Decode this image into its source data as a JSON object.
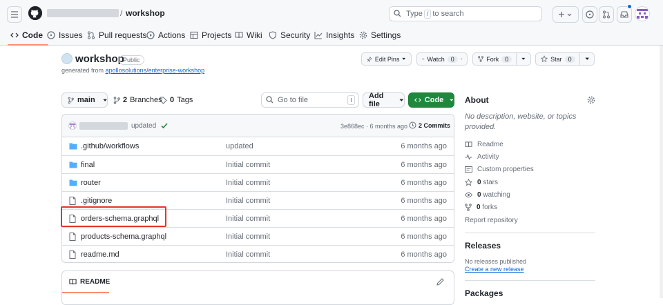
{
  "header": {
    "repo_name": "workshop",
    "slash": "/",
    "search_prefix": "Type",
    "search_key": "/",
    "search_suffix": "to search"
  },
  "tabs": [
    {
      "label": "Code",
      "icon": "code-icon",
      "active": true
    },
    {
      "label": "Issues",
      "icon": "issue-icon"
    },
    {
      "label": "Pull requests",
      "icon": "pull-request-icon"
    },
    {
      "label": "Actions",
      "icon": "play-icon"
    },
    {
      "label": "Projects",
      "icon": "table-icon"
    },
    {
      "label": "Wiki",
      "icon": "book-icon"
    },
    {
      "label": "Security",
      "icon": "shield-icon"
    },
    {
      "label": "Insights",
      "icon": "graph-icon"
    },
    {
      "label": "Settings",
      "icon": "gear-icon"
    }
  ],
  "repo": {
    "title": "workshop",
    "visibility": "Public",
    "generated_prefix": "generated from",
    "generated_link": "apollosolutions/enterprise-workshop",
    "edit_pins": "Edit Pins",
    "watch": "Watch",
    "watch_count": "0",
    "fork": "Fork",
    "fork_count": "0",
    "star": "Star",
    "star_count": "0"
  },
  "toolbar": {
    "branch": "main",
    "branches_count": "2",
    "branches_label": "Branches",
    "tags_count": "0",
    "tags_label": "Tags",
    "go_to_file": "Go to file",
    "go_to_file_key": "t",
    "add_file": "Add file",
    "code": "Code"
  },
  "latest_commit": {
    "message": "updated",
    "hash_time": "3e868ec · 6 months ago",
    "commits": "2 Commits"
  },
  "files": [
    {
      "name": ".github/workflows",
      "type": "folder",
      "message": "updated",
      "date": "6 months ago"
    },
    {
      "name": "final",
      "type": "folder",
      "message": "Initial commit",
      "date": "6 months ago"
    },
    {
      "name": "router",
      "type": "folder",
      "message": "Initial commit",
      "date": "6 months ago"
    },
    {
      "name": ".gitignore",
      "type": "file",
      "message": "Initial commit",
      "date": "6 months ago"
    },
    {
      "name": "orders-schema.graphql",
      "type": "file",
      "message": "Initial commit",
      "date": "6 months ago"
    },
    {
      "name": "products-schema.graphql",
      "type": "file",
      "message": "Initial commit",
      "date": "6 months ago"
    },
    {
      "name": "readme.md",
      "type": "file",
      "message": "Initial commit",
      "date": "6 months ago"
    }
  ],
  "readme": {
    "title": "README"
  },
  "about": {
    "title": "About",
    "description": "No description, website, or topics provided.",
    "readme": "Readme",
    "activity": "Activity",
    "custom_properties": "Custom properties",
    "stars_count": "0",
    "stars_label": "stars",
    "watching_count": "0",
    "watching_label": "watching",
    "forks_count": "0",
    "forks_label": "forks",
    "report": "Report repository",
    "releases_title": "Releases",
    "no_releases": "No releases published",
    "create_release": "Create a new release",
    "packages_title": "Packages"
  },
  "colors": {
    "accent_tab": "#fd8c73",
    "code_button": "#1f883d",
    "link": "#0969da",
    "highlight": "#e0362c"
  }
}
